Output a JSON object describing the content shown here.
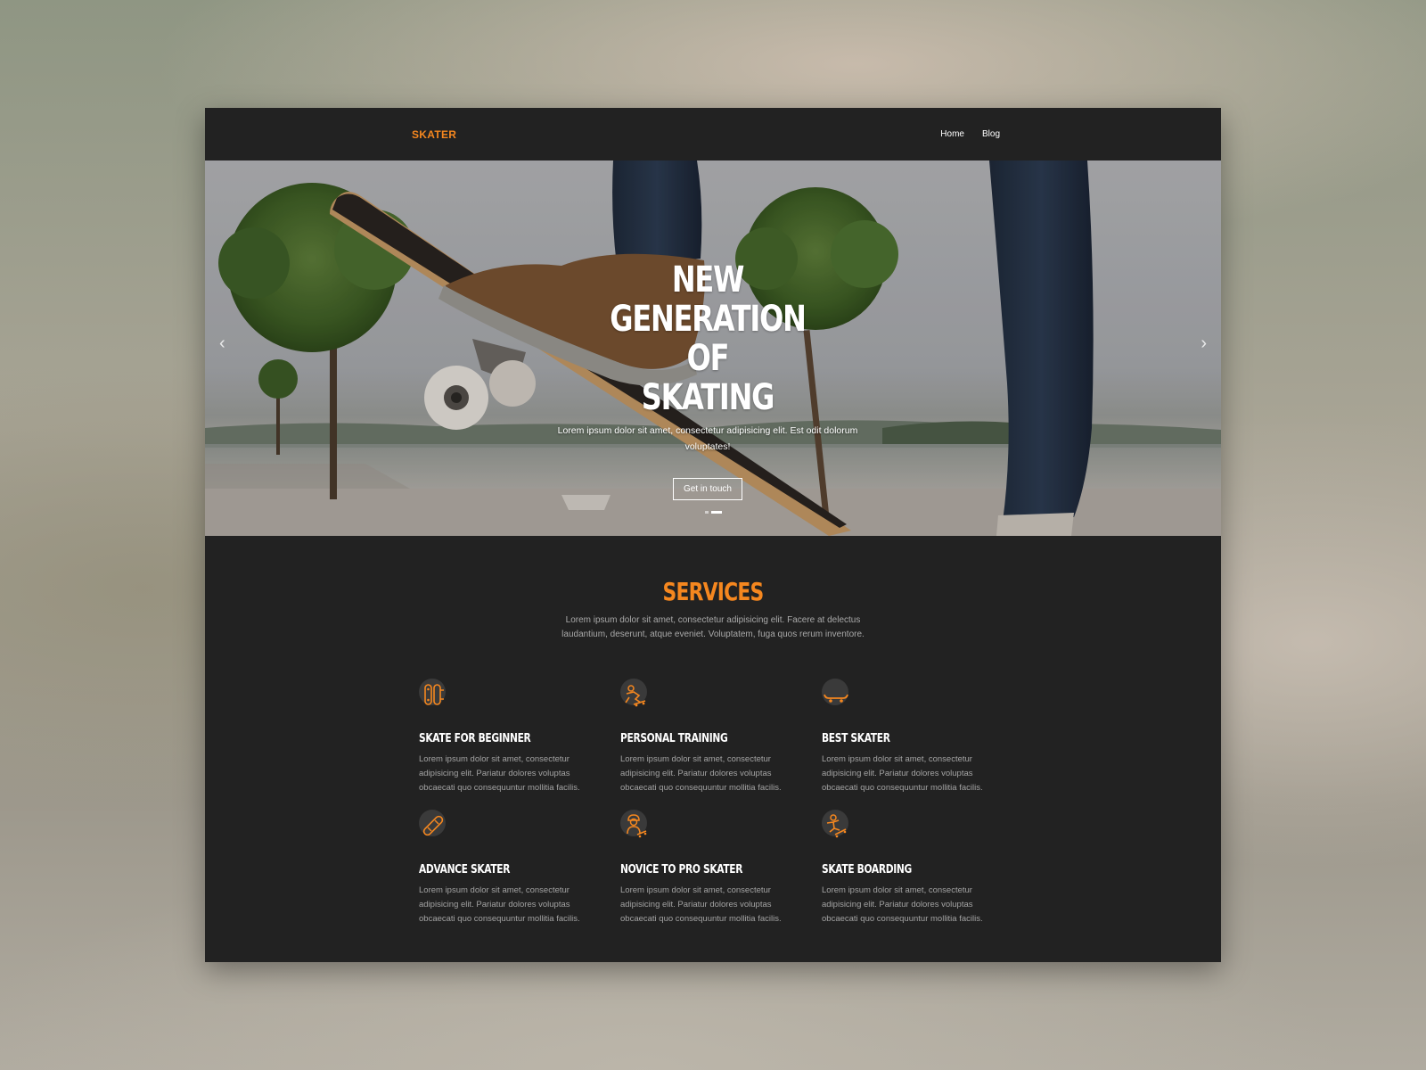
{
  "navbar": {
    "brand": "SKATER",
    "links": [
      "Home",
      "Blog"
    ]
  },
  "hero": {
    "title_line1": "NEW GENERATION OF",
    "title_line2": "SKATING",
    "subtitle": "Lorem ipsum dolor sit amet, consectetur adipisicing elit. Est odit dolorum voluptates!",
    "button": "Get in touch",
    "prev_arrow": "‹",
    "next_arrow": "›",
    "slide_count": 2,
    "active_slide": 2
  },
  "services": {
    "title": "SERVICES",
    "subtitle": "Lorem ipsum dolor sit amet, consectetur adipisicing elit. Facere at delectus laudantium, deserunt, atque eveniet. Voluptatem, fuga quos rerum inventore.",
    "items": [
      {
        "title": "SKATE FOR BEGINNER",
        "text": "Lorem ipsum dolor sit amet, consectetur adipisicing elit. Pariatur dolores voluptas obcaecati quo consequuntur mollitia facilis.",
        "icon": "skateboard-pair-icon"
      },
      {
        "title": "PERSONAL TRAINING",
        "text": "Lorem ipsum dolor sit amet, consectetur adipisicing elit. Pariatur dolores voluptas obcaecati quo consequuntur mollitia facilis.",
        "icon": "skater-training-icon"
      },
      {
        "title": "BEST SKATER",
        "text": "Lorem ipsum dolor sit amet, consectetur adipisicing elit. Pariatur dolores voluptas obcaecati quo consequuntur mollitia facilis.",
        "icon": "skateboard-side-icon"
      },
      {
        "title": "ADVANCE SKATER",
        "text": "Lorem ipsum dolor sit amet, consectetur adipisicing elit. Pariatur dolores voluptas obcaecati quo consequuntur mollitia facilis.",
        "icon": "skateboard-diagonal-icon"
      },
      {
        "title": "NOVICE TO PRO SKATER",
        "text": "Lorem ipsum dolor sit amet, consectetur adipisicing elit. Pariatur dolores voluptas obcaecati quo consequuntur mollitia facilis.",
        "icon": "skater-person-icon"
      },
      {
        "title": "SKATE BOARDING",
        "text": "Lorem ipsum dolor sit amet, consectetur adipisicing elit. Pariatur dolores voluptas obcaecati quo consequuntur mollitia facilis.",
        "icon": "skater-jump-icon"
      }
    ]
  },
  "colors": {
    "accent": "#f5871f",
    "background": "#222222",
    "text_muted": "#a9a9a9"
  }
}
